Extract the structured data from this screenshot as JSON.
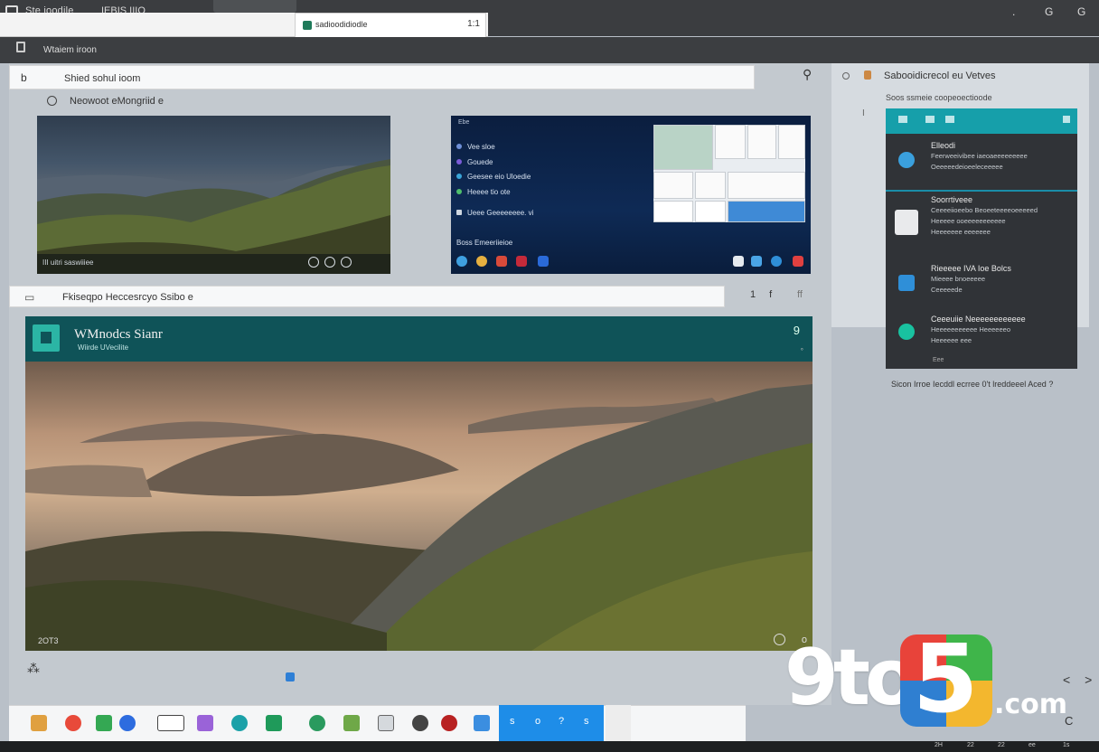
{
  "topbar": {
    "title": "Ste ioodile",
    "title2": "IEBIS IIIO",
    "tab_label": "sadioodidiodle",
    "tab_close": "1:1",
    "controls": [
      ".",
      "G",
      "G"
    ]
  },
  "secondbar": {
    "label": "Wtaiem iroon"
  },
  "bar1": {
    "glyph": "b",
    "label": "Shied sohul ioom"
  },
  "sub1": {
    "label": "Neowoot eMongriid e"
  },
  "thumb1": {
    "footer": "III uitri saswiiiee"
  },
  "thumb2": {
    "header": "Ebe",
    "items": [
      "Vee sloe",
      "Gouede",
      "Geesee eio Uloedie",
      "Heeee tio ote",
      "Ueee Geeeeeeee. vi"
    ],
    "mid_label": "Boss   Emeeriieioe"
  },
  "bar2": {
    "label": "Fkiseqpo Heccesrcyo Ssibo e",
    "icons": "1 f",
    "right": "ff"
  },
  "mainwin": {
    "title": "WMnodcs Sianr",
    "subtitle": "Wiirde UVecilite",
    "help": "9",
    "caption_left": "2OT3",
    "caption_right": "o"
  },
  "lower_glyph": "⁂",
  "taskbar": {
    "sel_labels": [
      "s",
      "o",
      "?",
      "s"
    ]
  },
  "bottomstrip": [
    "2H",
    "22",
    "22",
    "ee",
    "1s"
  ],
  "rightpanel": {
    "title": "Sabooidicrecol eu Vetves",
    "subtitle": "Soos ssmeie coopeoectioode",
    "line": "I",
    "card": {
      "sections": [
        {
          "title": "Elleodi",
          "desc1": "Feerweeivibee iaeoaeeeeeeeee",
          "desc2": "Oeeeeedeioeeleceeeee"
        },
        {
          "title": "Soorrtiveee",
          "desc1": "Ceeeeiioeebo Beoeeteeeeoeeeeed",
          "desc2": "Heeeee ooeeeeeeeeeee",
          "desc3": "Heeeeeee eeeeeee"
        },
        {
          "title": "Rieeeee IVA Ioe Bolcs",
          "desc1": "Mieeee bnoeeeee",
          "desc2": "Ceeeeede"
        },
        {
          "title": "Ceeeuiie Neeeeeeeeeeee",
          "desc1": "Heeeeeeeeeee Heeeeeeo",
          "desc2": "Heeeeee eee"
        }
      ],
      "footer": "Eee"
    },
    "caption": "Sicon Irroe Iecddl ecrree 0't lreddeeel Aced ?"
  },
  "watermark": {
    "nine_to": "9to",
    "five": "5",
    "dot_com": ".com"
  },
  "chevrons": "< >",
  "corner": "C",
  "colors": {
    "teal_header": "#0f5358",
    "accent_blue": "#1e8de8",
    "card_teal": "#169faa"
  }
}
